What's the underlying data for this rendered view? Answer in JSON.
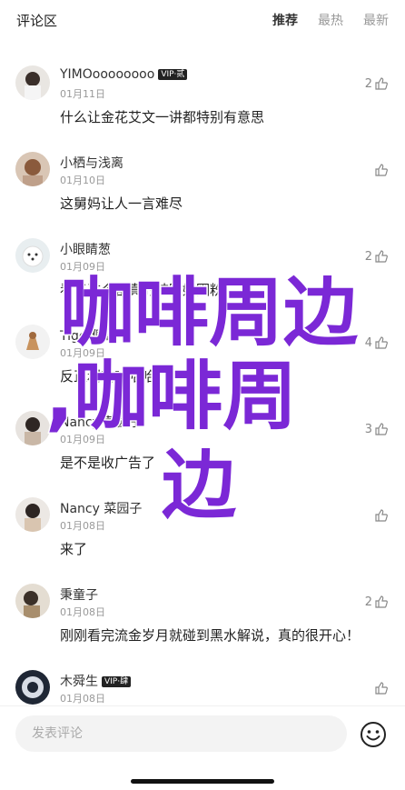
{
  "header": {
    "title": "评论区",
    "tabs": [
      "推荐",
      "最热",
      "最新"
    ]
  },
  "comments": [
    {
      "user": "YIMOoooooooo",
      "vip": "VIP·贰",
      "date": "01月11日",
      "text": "什么让金花艾文一讲都特别有意思",
      "likes": "2"
    },
    {
      "user": "小栖与浅离",
      "vip": "",
      "date": "01月10日",
      "text": "这舅妈让人一言难尽",
      "likes": ""
    },
    {
      "user": "小眼睛葱",
      "vip": "",
      "date": "01月09日",
      "text": "看了这个剧真的被陈妮圈粉",
      "likes": "2"
    },
    {
      "user": "Tiger佩奇",
      "vip": "",
      "date": "01月09日",
      "text": "反正利哈哈哈哈",
      "likes": "4"
    },
    {
      "user": "Nancy 菜园子",
      "vip": "",
      "date": "01月09日",
      "text": "是不是收广告了",
      "likes": "3"
    },
    {
      "user": "Nancy 菜园子",
      "vip": "",
      "date": "01月08日",
      "text": "来了",
      "likes": ""
    },
    {
      "user": "秉童子",
      "vip": "",
      "date": "01月08日",
      "text": "刚刚看完流金岁月就碰到黑水解说，真的很开心！",
      "likes": "2"
    },
    {
      "user": "木舜生",
      "vip": "VIP·肆",
      "date": "01月08日",
      "text": "",
      "likes": ""
    }
  ],
  "input": {
    "placeholder": "发表评论"
  },
  "overlay": {
    "line1": "咖啡周边",
    "line2": ",咖啡周",
    "line3": "边"
  },
  "colors": {
    "overlay": "#7b28d6"
  }
}
